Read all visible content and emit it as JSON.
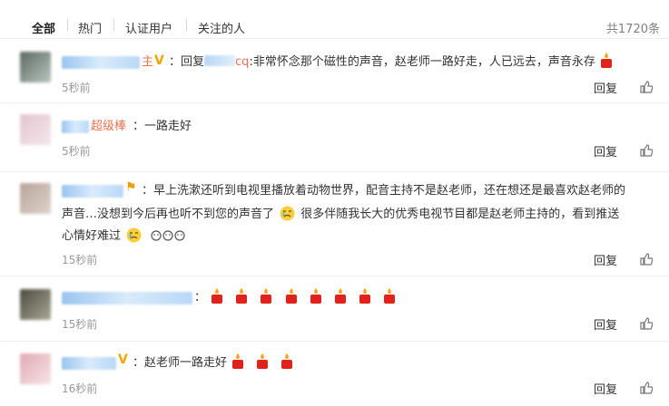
{
  "tabs": {
    "all": "全部",
    "hot": "热门",
    "verified": "认证用户",
    "following": "关注的人",
    "total": "共1720条"
  },
  "comments": [
    {
      "name_suffix": "主",
      "reply_prefix": "回复",
      "reply_to_suffix": "cq",
      "text": ":非常怀念那个磁性的声音，赵老师一路好走，人已远去，声音永存",
      "time": "5秒前",
      "reply": "回复"
    },
    {
      "name_suffix": "超级棒",
      "text": "：一路走好",
      "time": "5秒前",
      "reply": "回复"
    },
    {
      "line1": "：早上洗漱还听到电视里播放着动物世界，配音主持不是赵老师，还在想还是最喜欢赵老师的",
      "line2a": "声音…没想到今后再也听不到您的声音了",
      "line2b": "很多伴随我长大的优秀电视节目都是赵老师主持的，看到推送",
      "line3": "心情好难过",
      "time": "15秒前",
      "reply": "回复"
    },
    {
      "text": "：",
      "time": "15秒前",
      "reply": "回复"
    },
    {
      "text": "：赵老师一路走好",
      "time": "16秒前",
      "reply": "回复"
    }
  ],
  "icons": {
    "vip": "V",
    "candle": "candle-icon",
    "cry": "crying-face-icon",
    "like": "thumbs-up-icon"
  },
  "colors": {
    "link": "#eb7350",
    "vip": "#f0a400",
    "time": "#999999"
  }
}
